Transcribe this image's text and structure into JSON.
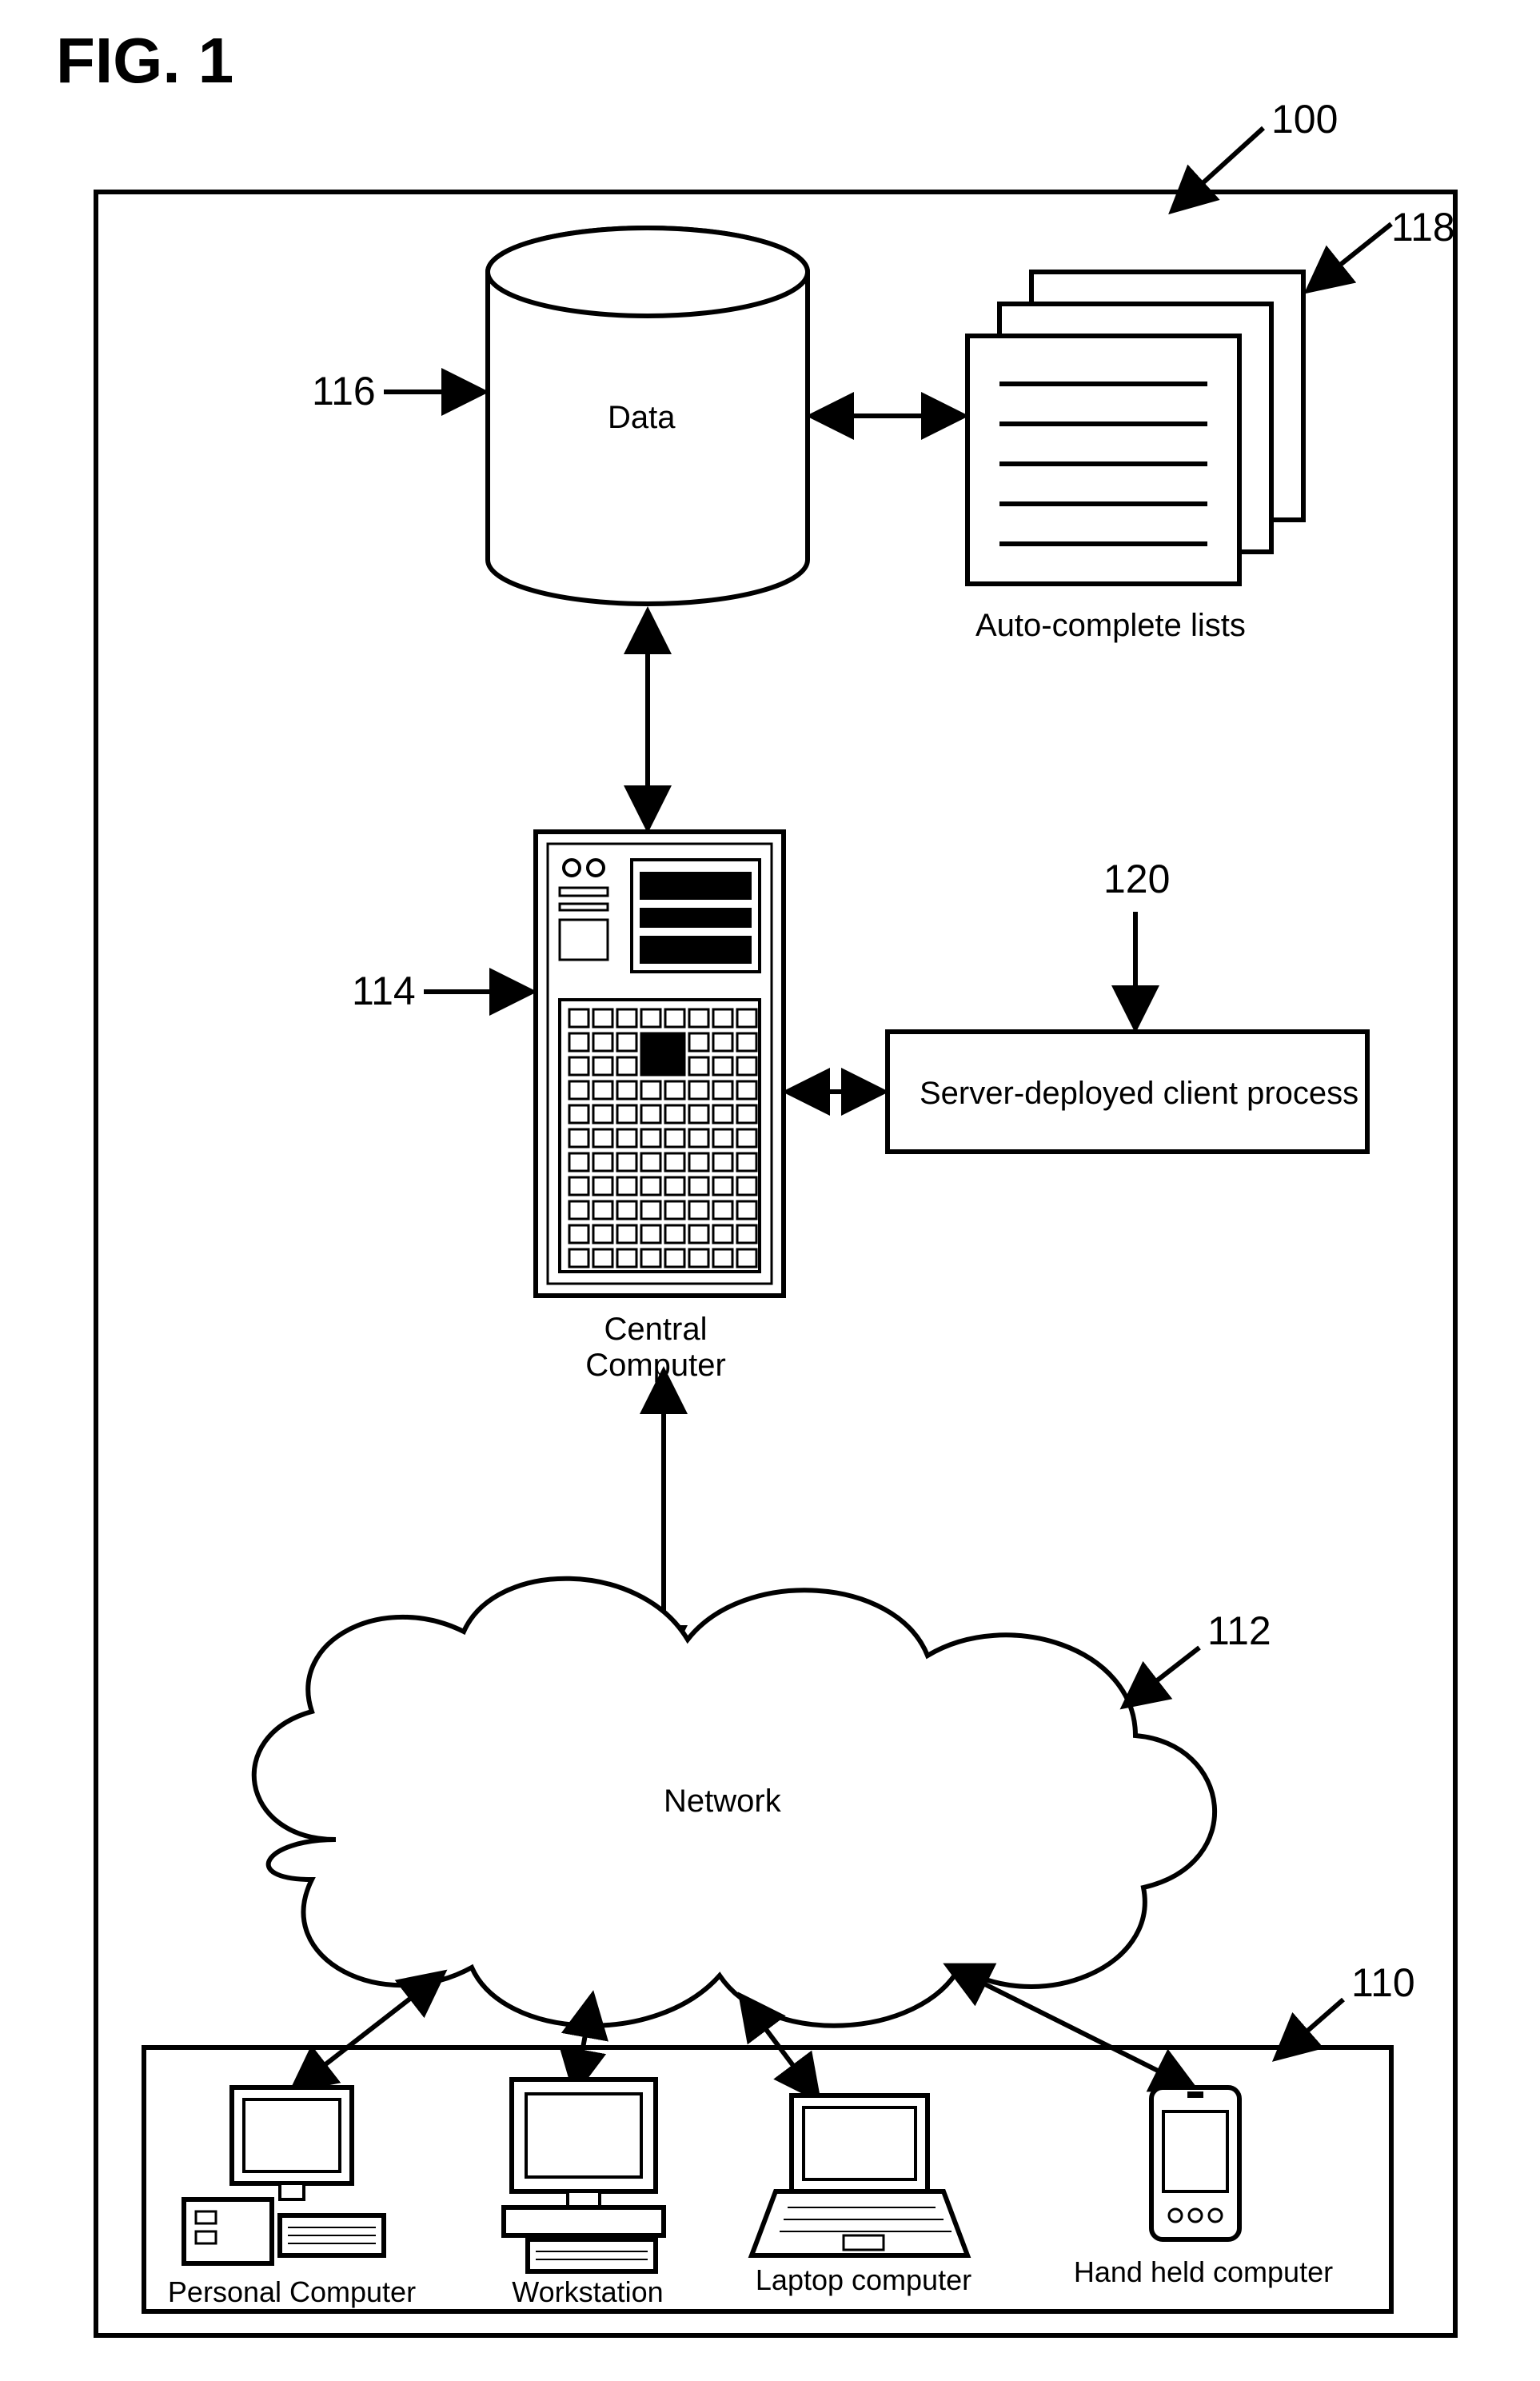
{
  "figure": {
    "title": "FIG. 1",
    "refs": {
      "system": "100",
      "clients_box": "110",
      "network": "112",
      "central_computer": "114",
      "data": "116",
      "autocomplete": "118",
      "server_process": "120"
    }
  },
  "labels": {
    "data": "Data",
    "autocomplete": "Auto-complete lists",
    "central_computer_line1": "Central",
    "central_computer_line2": "Computer",
    "server_process": "Server-deployed client process",
    "network": "Network",
    "personal_computer": "Personal Computer",
    "workstation": "Workstation",
    "laptop": "Laptop computer",
    "handheld": "Hand held computer"
  }
}
